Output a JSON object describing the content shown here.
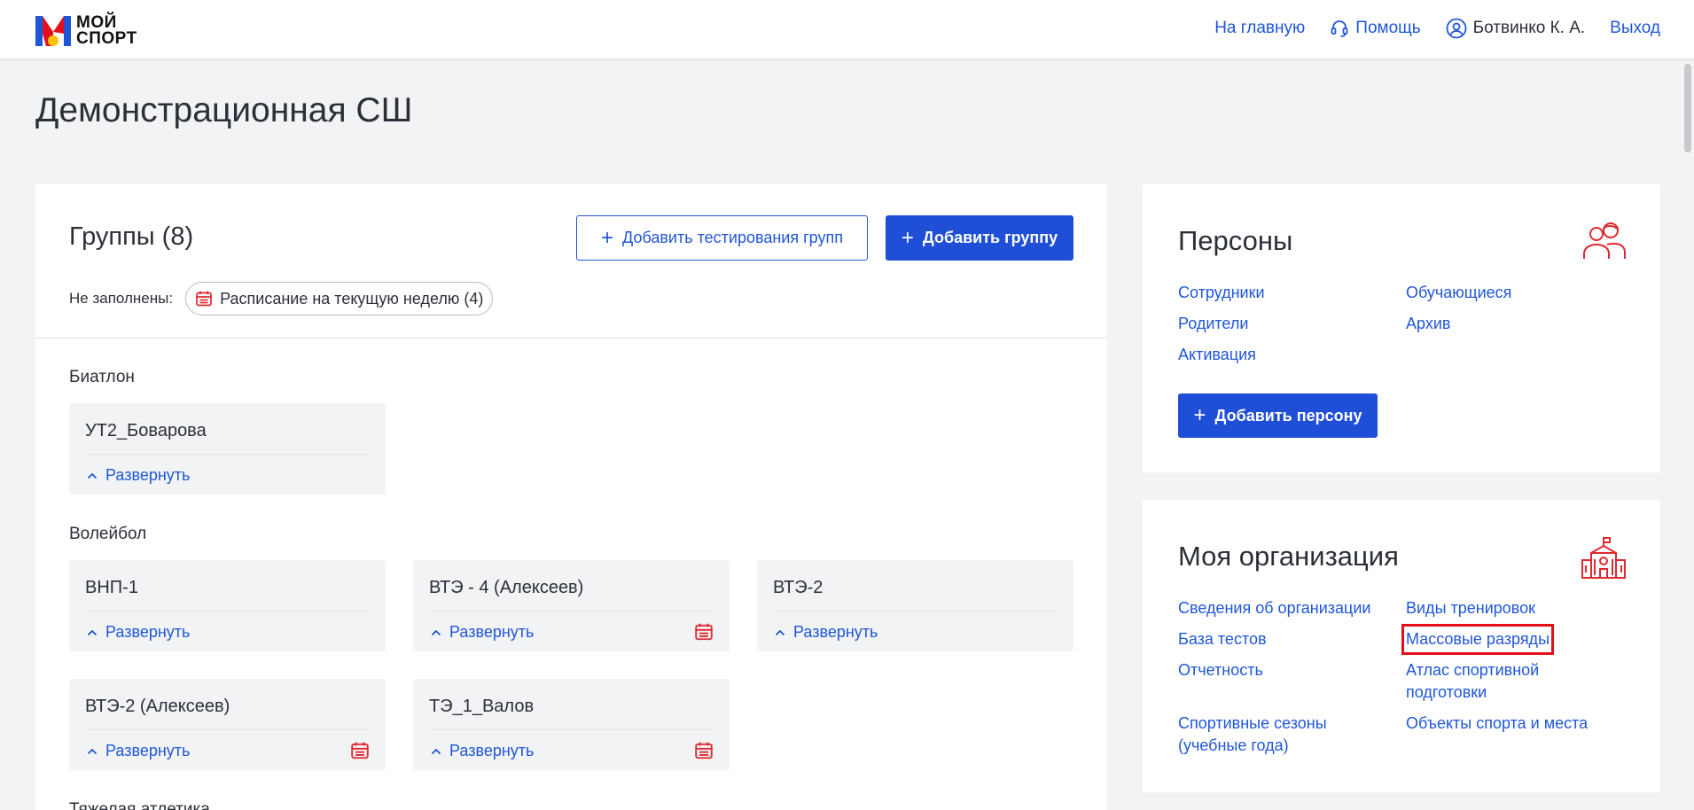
{
  "header": {
    "logo_line1": "МОЙ",
    "logo_line2": "СПОРТ",
    "nav_home": "На главную",
    "nav_help": "Помощь",
    "user_name": "Ботвинко К. А.",
    "nav_logout": "Выход"
  },
  "page": {
    "title": "Демонстрационная СШ"
  },
  "groups": {
    "title": "Группы (8)",
    "add_tests_label": "Добавить тестирования групп",
    "add_group_label": "Добавить группу",
    "not_filled_label": "Не заполнены:",
    "schedule_chip_label": "Расписание на текущую неделю (4)",
    "expand_label": "Развернуть",
    "sports": [
      {
        "name": "Биатлон",
        "cards": [
          {
            "name": "УТ2_Боварова",
            "calendar": false
          }
        ]
      },
      {
        "name": "Волейбол",
        "cards": [
          {
            "name": "ВНП-1",
            "calendar": false
          },
          {
            "name": "ВТЭ - 4 (Алексеев)",
            "calendar": true
          },
          {
            "name": "ВТЭ-2",
            "calendar": false
          },
          {
            "name": "ВТЭ-2 (Алексеев)",
            "calendar": true
          },
          {
            "name": "ТЭ_1_Валов",
            "calendar": true
          }
        ]
      },
      {
        "name": "Тяжелая атлетика",
        "cards": []
      }
    ]
  },
  "persons": {
    "title": "Персоны",
    "links": [
      "Сотрудники",
      "Обучающиеся",
      "Родители",
      "Архив",
      "Активация"
    ],
    "add_person_label": "Добавить персону"
  },
  "organization": {
    "title": "Моя организация",
    "links": [
      "Сведения об организации",
      "Виды тренировок",
      "База тестов",
      "Массовые разряды",
      "Отчетность",
      "Атлас спортивной подготовки",
      "Спортивные сезоны (учебные года)",
      "Объекты спорта и места"
    ],
    "highlighted_link": "Массовые разряды"
  },
  "colors": {
    "accent": "#1f56d8",
    "primary_button": "#1f4fd6",
    "highlight": "#e3101b",
    "icon_red": "#e0282e"
  }
}
